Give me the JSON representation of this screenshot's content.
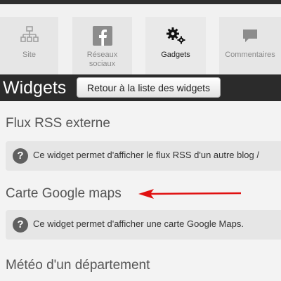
{
  "nav": {
    "tabs": [
      {
        "label": "Site",
        "icon": "sitemap-icon"
      },
      {
        "label": "Réseaux sociaux",
        "icon": "facebook-icon"
      },
      {
        "label": "Gadgets",
        "icon": "gears-icon",
        "active": true
      },
      {
        "label": "Commentaires",
        "icon": "comment-icon"
      }
    ]
  },
  "header": {
    "title": "Widgets",
    "back_button": "Retour à la liste des widgets"
  },
  "widgets": [
    {
      "title": "Flux RSS externe",
      "description": "Ce widget permet d'afficher le flux RSS d'un autre blog /"
    },
    {
      "title": "Carte Google maps",
      "description": "Ce widget permet d'afficher une carte Google Maps."
    },
    {
      "title": "Météo d'un département"
    }
  ],
  "colors": {
    "arrow": "#e01010",
    "header_bg": "#2b2b2b"
  }
}
